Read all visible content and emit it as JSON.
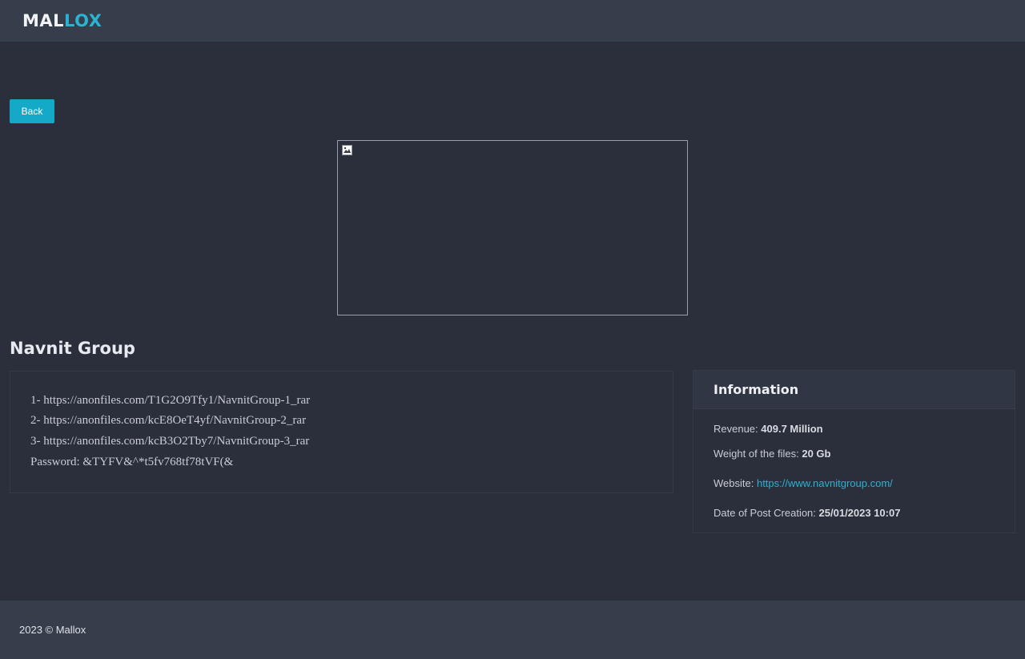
{
  "header": {
    "logo_part1": "MAL",
    "logo_part2": "LOX"
  },
  "actions": {
    "back_label": "Back"
  },
  "post": {
    "title": "Navnit Group",
    "links": [
      "1- https://anonfiles.com/T1G2O9Tfy1/NavnitGroup-1_rar",
      "2- https://anonfiles.com/kcE8OeT4yf/NavnitGroup-2_rar",
      "3- https://anonfiles.com/kcB3O2Tby7/NavnitGroup-3_rar"
    ],
    "password_line": "Password: &TYFV&^*t5fv768tf78tVF(&"
  },
  "info": {
    "title": "Information",
    "revenue_label": "Revenue:",
    "revenue_value": "409.7 Million",
    "weight_label": "Weight of the files:",
    "weight_value": "20 Gb",
    "website_label": "Website:",
    "website_value": "https://www.navnitgroup.com/",
    "date_label": "Date of Post Creation:",
    "date_value": "25/01/2023 10:07"
  },
  "footer": {
    "text": "2023 © Mallox"
  },
  "icons": {
    "broken_image": "broken-image-icon"
  },
  "colors": {
    "accent": "#15a9c9",
    "background": "#2a2f3b",
    "bar": "#363d4b"
  }
}
